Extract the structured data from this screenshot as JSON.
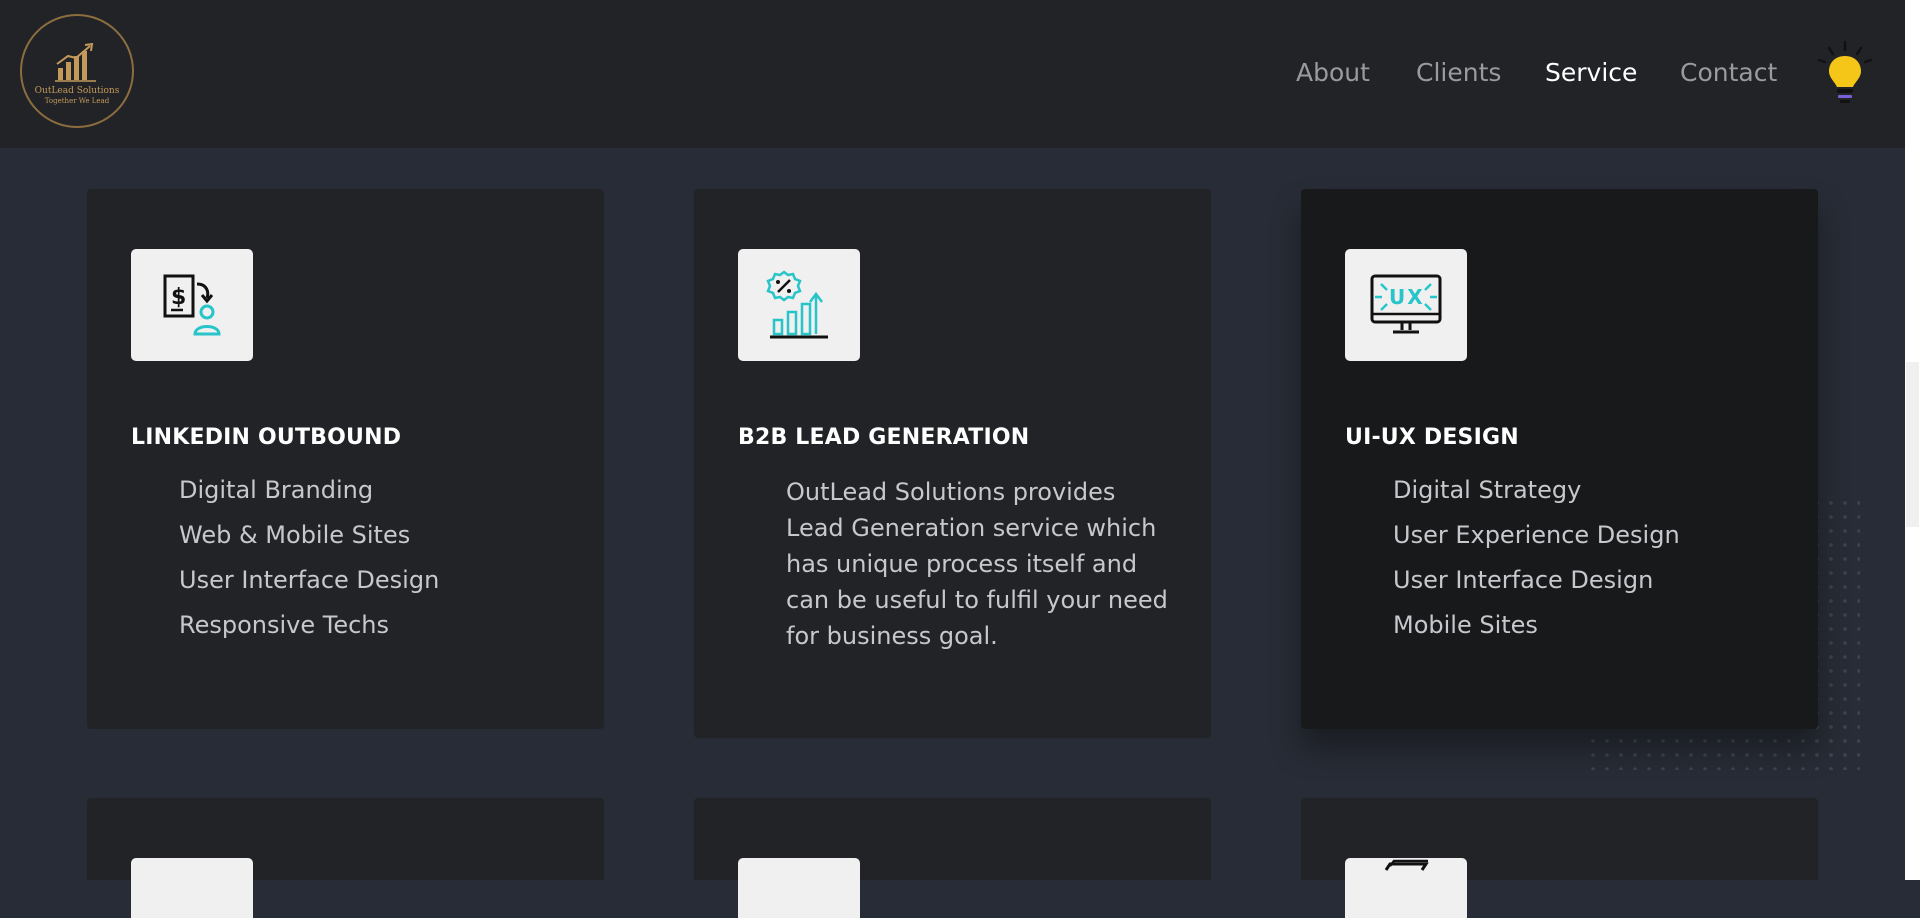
{
  "brand": {
    "name": "OutLead Solutions",
    "tagline": "Together We Lead",
    "gold": "#c49a5a"
  },
  "nav": {
    "items": [
      {
        "label": "About",
        "active": false
      },
      {
        "label": "Clients",
        "active": false
      },
      {
        "label": "Service",
        "active": true
      },
      {
        "label": "Contact",
        "active": false
      }
    ],
    "theme_toggle_icon": "lightbulb-icon"
  },
  "services": [
    {
      "title": "LINKEDIN OUTBOUND",
      "icon": "invoice-user-icon",
      "items": [
        "Digital Branding",
        "Web & Mobile Sites",
        "User Interface Design",
        "Responsive Techs"
      ]
    },
    {
      "title": "B2B LEAD GENERATION",
      "icon": "discount-growth-chart-icon",
      "description": "OutLead Solutions provides Lead Generation service which has unique process itself and can be useful to fulfil your need for business goal."
    },
    {
      "title": "UI-UX DESIGN",
      "icon": "ux-monitor-icon",
      "items": [
        "Digital Strategy",
        "User Experience Design",
        "User Interface Design",
        "Mobile Sites"
      ],
      "highlighted": true
    }
  ],
  "colors": {
    "background": "#282c36",
    "header": "#212327",
    "card": "#212327",
    "card_highlight": "#18191b",
    "accent": "#27c4c9",
    "bulb": "#f5c518"
  }
}
